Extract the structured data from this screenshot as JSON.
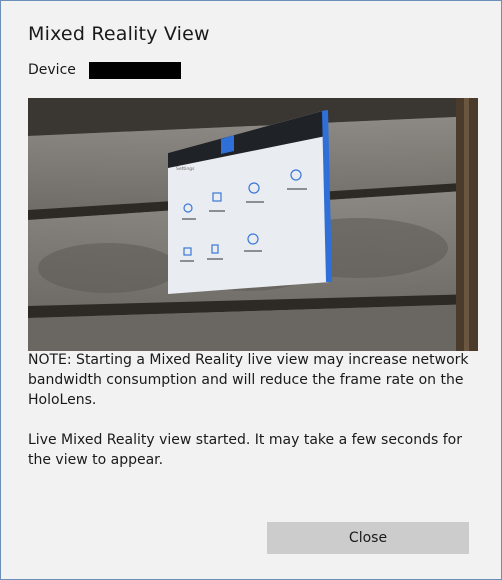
{
  "dialog": {
    "title": "Mixed Reality View",
    "device_label": "Device",
    "device_value": "",
    "note": "NOTE: Starting a Mixed Reality live view may increase network bandwidth consumption and will reduce the frame rate on the HoloLens.",
    "status": "Live Mixed Reality view started. It may take a few seconds for the view to appear.",
    "close_label": "Close"
  },
  "video": {
    "settings_title": "Settings"
  },
  "colors": {
    "dialog_bg": "#f2f2f2",
    "dialog_border": "#6b8fb8",
    "button_bg": "#cccccc",
    "accent": "#2e6fd8",
    "redaction": "#000000"
  }
}
